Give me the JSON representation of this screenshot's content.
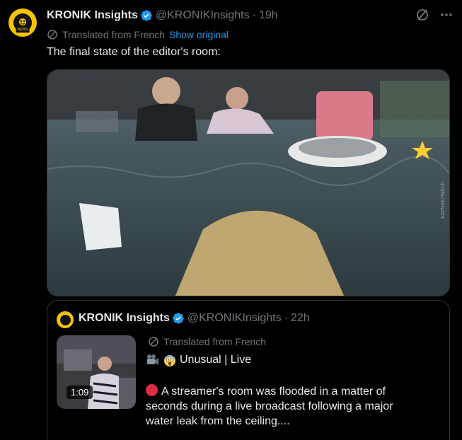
{
  "post": {
    "display_name": "KRONIK Insights",
    "handle": "@KRONIKInsights",
    "separator": "·",
    "time": "19h",
    "translated_label": "Translated from French",
    "show_original": "Show original",
    "text": "The final state of the editor's room:",
    "avatar_tag": "NEWS"
  },
  "quote": {
    "display_name": "KRONIK Insights",
    "handle": "@KRONIKInsights",
    "separator": "·",
    "time": "22h",
    "translated_label": "Translated from French",
    "title": "Unusual | Live",
    "body": "A streamer's room was flooded in a matter of seconds during a live broadcast following a major water leak from the ceiling....",
    "video_duration": "1:09"
  },
  "colors": {
    "background": "#000000",
    "text": "#e7e9ea",
    "muted": "#71767b",
    "link": "#1d9bf0",
    "verified": "#1d9bf0",
    "brand": "#f5c400",
    "border": "#2f3336"
  },
  "icons": {
    "verified": "verified-badge-icon",
    "translate": "translate-icon",
    "grok": "grok-icon",
    "more": "more-options-icon",
    "camera_emoji": "movie-camera-icon",
    "scream_emoji": "screaming-face-icon",
    "live_dot": "red-circle-icon"
  }
}
